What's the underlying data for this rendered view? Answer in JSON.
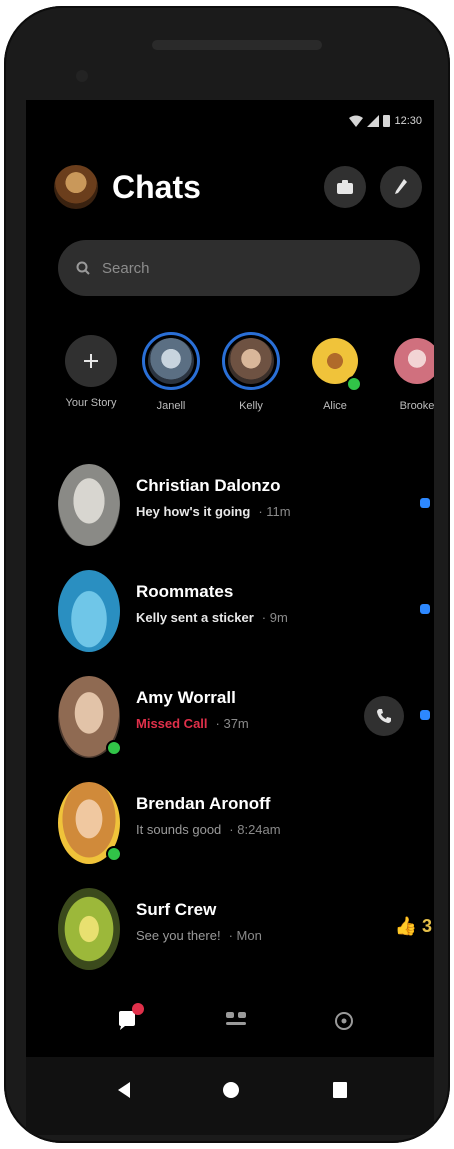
{
  "status_bar": {
    "time": "12:30"
  },
  "header": {
    "title": "Chats"
  },
  "search": {
    "placeholder": "Search"
  },
  "stories": [
    {
      "name": "Your Story"
    },
    {
      "name": "Janell"
    },
    {
      "name": "Kelly"
    },
    {
      "name": "Alice"
    },
    {
      "name": "Brooke"
    }
  ],
  "chats": [
    {
      "name": "Christian Dalonzo",
      "message": "Hey how's it going",
      "time": "· 11m",
      "unread": true
    },
    {
      "name": "Roommates",
      "message": "Kelly sent a sticker",
      "time": "· 9m",
      "unread": true
    },
    {
      "name": "Amy Worrall",
      "message": "Missed Call",
      "time": "· 37m",
      "unread": true,
      "missed_call": true
    },
    {
      "name": "Brendan Aronoff",
      "message": "It sounds good",
      "time": "· 8:24am",
      "unread": false
    },
    {
      "name": "Surf Crew",
      "message": "See you there!",
      "time": "· Mon",
      "unread": false,
      "reaction": "👍 3"
    }
  ],
  "colors": {
    "accent": "#2d88ff",
    "missed": "#e0304a",
    "online": "#31c448",
    "background": "#000000"
  },
  "icons": {
    "header_camera": "camera-icon",
    "header_compose": "compose-icon",
    "search": "search-icon",
    "nav_chats": "chat-icon",
    "nav_people": "people-icon",
    "nav_discover": "compass-icon"
  }
}
